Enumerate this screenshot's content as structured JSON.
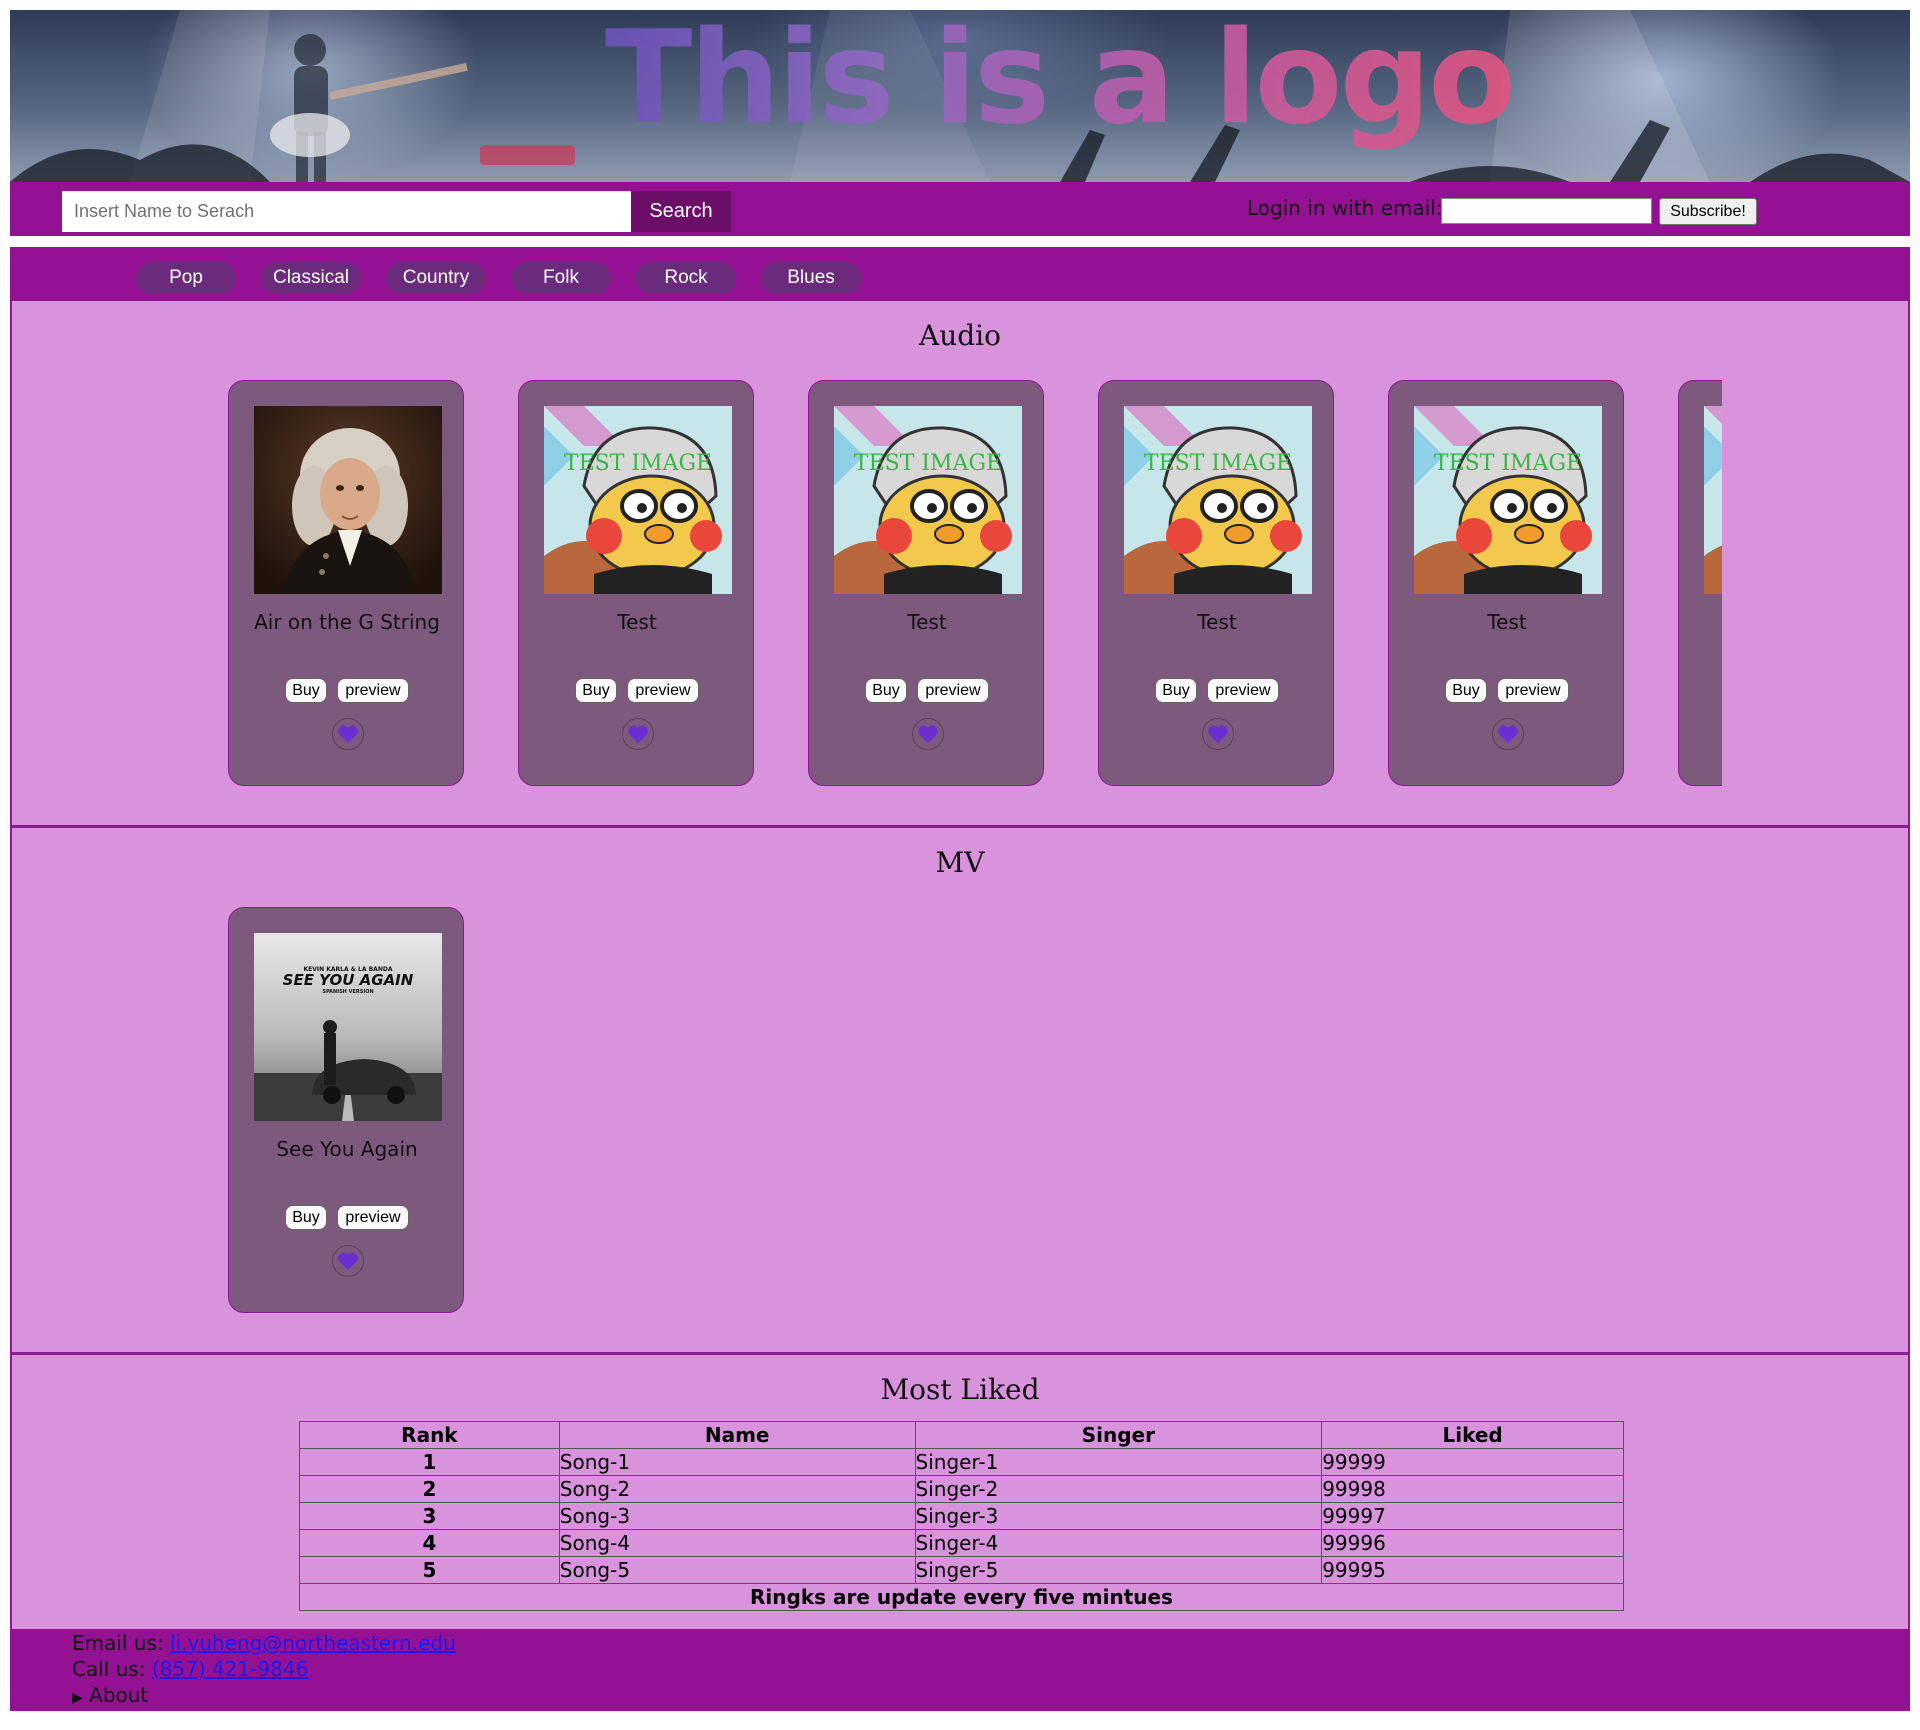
{
  "banner": {
    "logo_text": "This is a logo"
  },
  "search": {
    "placeholder": "Insert Name to Serach",
    "button_label": "Search"
  },
  "login": {
    "label": "Login in with email:",
    "subscribe_label": "Subscribe!"
  },
  "genres": [
    "Pop",
    "Classical",
    "Country",
    "Folk",
    "Rock",
    "Blues"
  ],
  "sections": {
    "audio_title": "Audio",
    "mv_title": "MV",
    "liked_title": "Most Liked"
  },
  "audio_cards": [
    {
      "title": "Air on the G String",
      "image": "bach-portrait",
      "buy": "Buy",
      "preview": "preview"
    },
    {
      "title": "Test",
      "image": "test-image",
      "image_text": "TEST IMAGE",
      "buy": "Buy",
      "preview": "preview"
    },
    {
      "title": "Test",
      "image": "test-image",
      "image_text": "TEST IMAGE",
      "buy": "Buy",
      "preview": "preview"
    },
    {
      "title": "Test",
      "image": "test-image",
      "image_text": "TEST IMAGE",
      "buy": "Buy",
      "preview": "preview"
    },
    {
      "title": "Test",
      "image": "test-image",
      "image_text": "TEST IMAGE",
      "buy": "Buy",
      "preview": "preview"
    },
    {
      "title": "",
      "image": "test-image",
      "image_text": "",
      "buy": "",
      "preview": ""
    }
  ],
  "mv_cards": [
    {
      "title": "See You Again",
      "image": "see-you-again-cover",
      "cover_artist": "KEVIN KARLA & LA BANDA",
      "cover_title": "SEE YOU AGAIN",
      "cover_subtitle": "SPANISH VERSION",
      "buy": "Buy",
      "preview": "preview"
    }
  ],
  "most_liked": {
    "columns": [
      "Rank",
      "Name",
      "Singer",
      "Liked"
    ],
    "rows": [
      [
        "1",
        "Song-1",
        "Singer-1",
        "99999"
      ],
      [
        "2",
        "Song-2",
        "Singer-2",
        "99998"
      ],
      [
        "3",
        "Song-3",
        "Singer-3",
        "99997"
      ],
      [
        "4",
        "Song-4",
        "Singer-4",
        "99996"
      ],
      [
        "5",
        "Song-5",
        "Singer-5",
        "99995"
      ]
    ],
    "footnote": "Ringks are update every five mintues"
  },
  "footer": {
    "email_label": "Email us:",
    "email": "li.yuheng@northeastern.edu",
    "phone_label": "Call us:",
    "phone": "(857) 421-9846",
    "about_label": "About",
    "about_marker": "▶"
  },
  "colors": {
    "bar_purple": "#941193",
    "section_pink": "#d993dc",
    "card_mauve": "#7d5a7d",
    "heart": "#6a2fd1",
    "link": "#1a1aee"
  }
}
